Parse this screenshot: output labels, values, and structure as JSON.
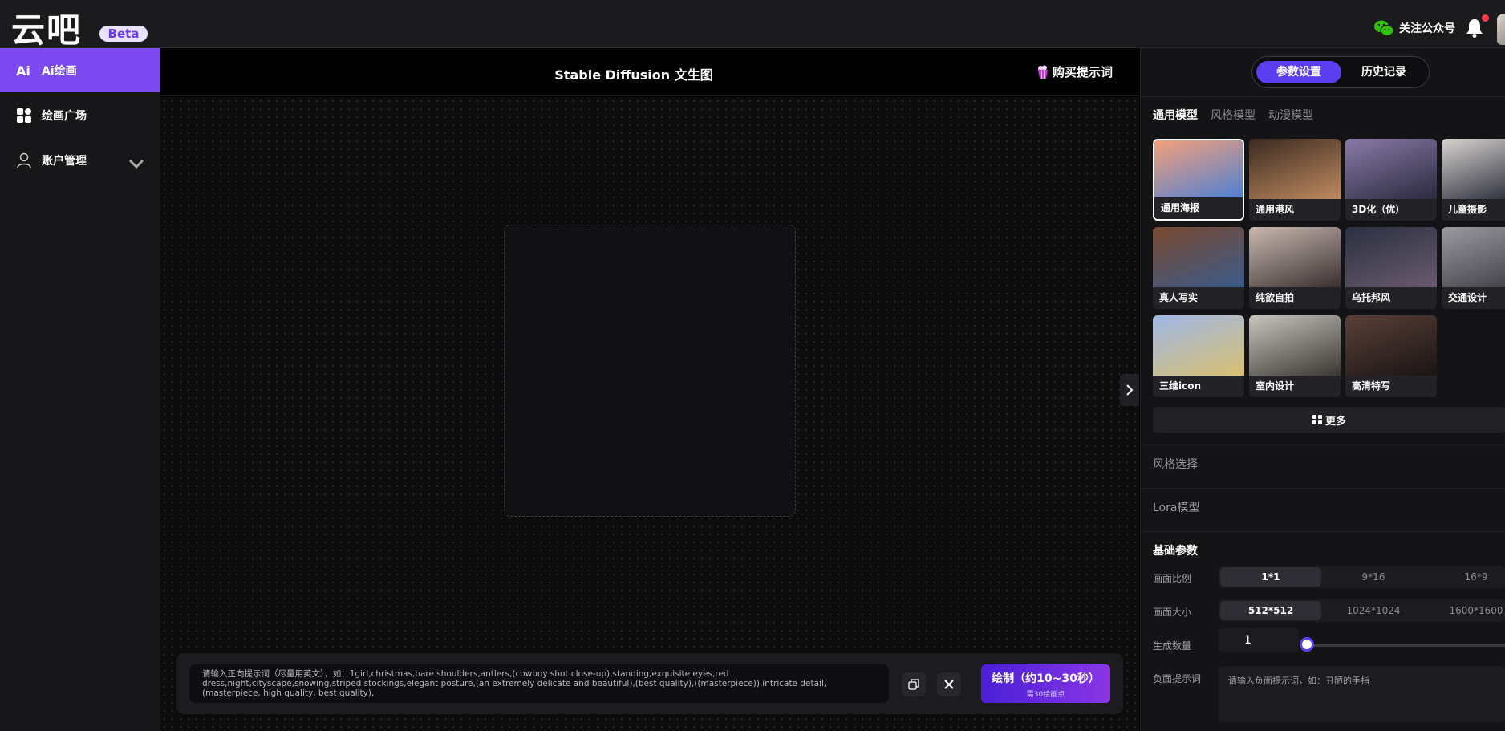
{
  "header": {
    "logo": "云吧",
    "beta": "Beta",
    "wechat_label": "关注公众号"
  },
  "sidebar": {
    "items": [
      {
        "label": "Ai绘画",
        "icon": "ai-icon",
        "active": true
      },
      {
        "label": "绘画广场",
        "icon": "grid-icon",
        "active": false
      },
      {
        "label": "账户管理",
        "icon": "user-icon",
        "active": false
      }
    ]
  },
  "center": {
    "title": "Stable Diffusion 文生图",
    "buy_label": "购买提示词",
    "prompt_placeholder": "请输入正向提示词（尽量用英文），如：1girl,christmas,bare shoulders,antlers,(cowboy shot close-up),standing,exquisite eyes,red dress,night,cityscape,snowing,striped stockings,elegant posture,(an extremely delicate and beautiful),(best quality),((masterpiece)),intricate detail,(masterpiece, high quality, best quality),",
    "draw_label": "绘制（约10~30秒）",
    "draw_cost": "需30绘画点"
  },
  "right": {
    "tabs": [
      {
        "label": "参数设置",
        "active": true
      },
      {
        "label": "历史记录",
        "active": false
      }
    ],
    "model_tabs": [
      {
        "label": "通用模型",
        "active": true
      },
      {
        "label": "风格模型",
        "active": false
      },
      {
        "label": "动漫模型",
        "active": false
      }
    ],
    "models": [
      {
        "label": "通用海报",
        "selected": true,
        "colors": [
          "#f4a07a",
          "#4a7fd6"
        ]
      },
      {
        "label": "通用港风",
        "selected": false,
        "colors": [
          "#3a2a20",
          "#c08a60"
        ]
      },
      {
        "label": "3D化（优）",
        "selected": false,
        "colors": [
          "#8a7aa8",
          "#2a2a3e"
        ]
      },
      {
        "label": "儿童摄影",
        "selected": false,
        "colors": [
          "#d8d4d0",
          "#1e2030"
        ]
      },
      {
        "label": "真人写实",
        "selected": false,
        "colors": [
          "#7a4a30",
          "#3a5a8a"
        ]
      },
      {
        "label": "纯欲自拍",
        "selected": false,
        "colors": [
          "#c8b8b0",
          "#3a3030"
        ]
      },
      {
        "label": "乌托邦风",
        "selected": false,
        "colors": [
          "#2a3040",
          "#6a5a70"
        ]
      },
      {
        "label": "交通设计",
        "selected": false,
        "colors": [
          "#9a9aa0",
          "#3a3a40"
        ]
      },
      {
        "label": "三维icon",
        "selected": false,
        "colors": [
          "#a0b8e8",
          "#d8c070"
        ]
      },
      {
        "label": "室内设计",
        "selected": false,
        "colors": [
          "#c8c4c0",
          "#3a3632"
        ]
      },
      {
        "label": "高清特写",
        "selected": false,
        "colors": [
          "#5a4038",
          "#1a1414"
        ]
      }
    ],
    "more_label": "更多",
    "style_label": "风格选择",
    "lora_label": "Lora模型",
    "basic_title": "基础参数",
    "ratio_label": "画面比例",
    "ratios": [
      {
        "label": "1*1",
        "active": true
      },
      {
        "label": "9*16",
        "active": false
      },
      {
        "label": "16*9",
        "active": false
      }
    ],
    "size_label": "画面大小",
    "sizes": [
      {
        "label": "512*512",
        "active": true
      },
      {
        "label": "1024*1024",
        "active": false
      },
      {
        "label": "1600*1600",
        "active": false
      }
    ],
    "count_label": "生成数量",
    "count_value": "1",
    "negative_label": "负面提示词",
    "negative_placeholder": "请输入负面提示词，如：丑陋的手指"
  },
  "colors": {
    "accent": "#7c4af0",
    "segment_active": "#5a3ef0"
  }
}
